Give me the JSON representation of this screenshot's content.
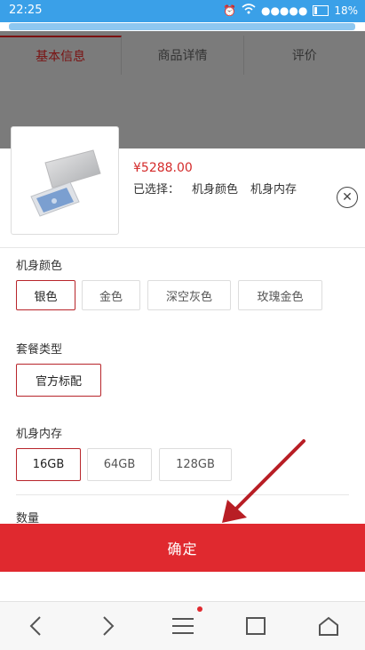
{
  "status_bar": {
    "time": "22:25",
    "battery": "18%",
    "signal": "●●●●●"
  },
  "tabs": [
    {
      "label": "基本信息",
      "active": true
    },
    {
      "label": "商品详情",
      "active": false
    },
    {
      "label": "评价",
      "active": false
    }
  ],
  "product": {
    "price": "¥5288.00",
    "selected_prefix": "已选择：",
    "selected_items": [
      "机身颜色",
      "机身内存"
    ]
  },
  "groups": {
    "color": {
      "label": "机身颜色",
      "options": [
        "银色",
        "金色",
        "深空灰色",
        "玫瑰金色"
      ],
      "selected": "银色"
    },
    "package": {
      "label": "套餐类型",
      "options": [
        "官方标配"
      ],
      "selected": "官方标配"
    },
    "storage": {
      "label": "机身内存",
      "options": [
        "16GB",
        "64GB",
        "128GB"
      ],
      "selected": "16GB"
    },
    "quantity": {
      "label": "数量"
    }
  },
  "confirm_label": "确定",
  "colors": {
    "accent": "#e0292f",
    "price": "#d42b2b",
    "status_bar": "#3aa0e8"
  }
}
